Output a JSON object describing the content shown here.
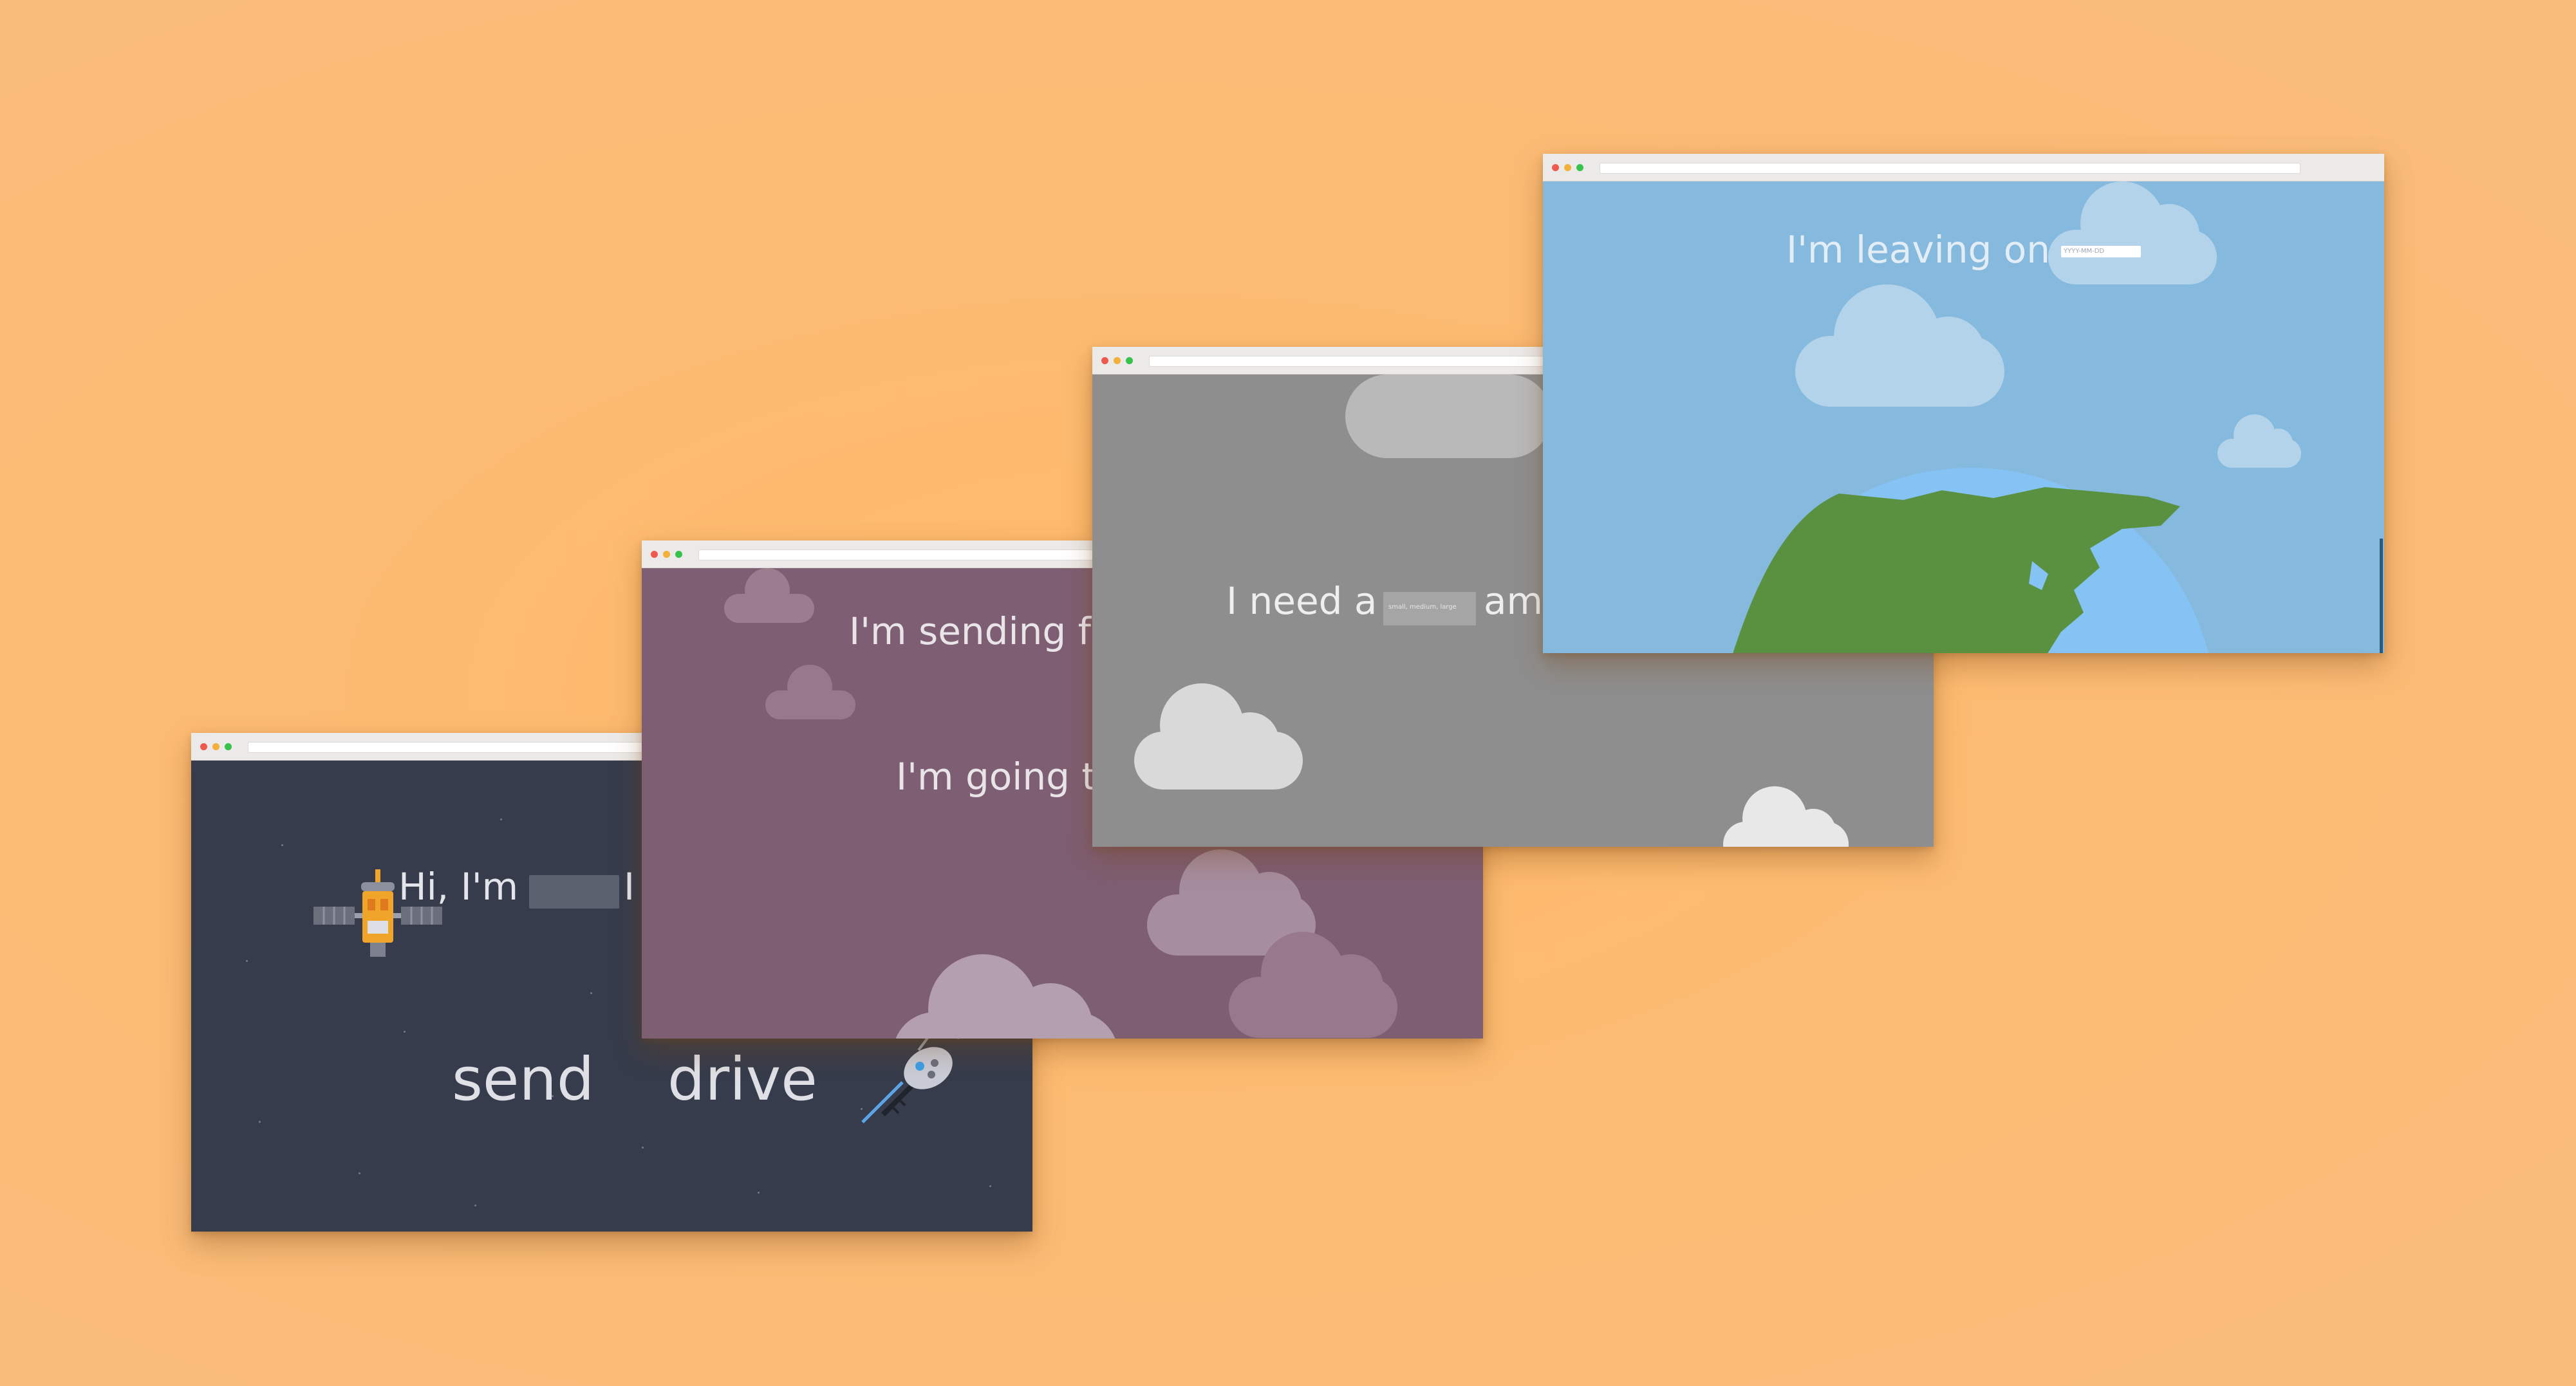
{
  "colors": {
    "background": "#fbbb75",
    "space": "#363c4b",
    "plum": "#7e5e72",
    "grey": "#8e8e8e",
    "sky": "#86b9de",
    "earth_ocean": "#85c3f5",
    "earth_land": "#5a9141"
  },
  "windows": [
    {
      "name": "space-window",
      "greeting": "Hi, I'm",
      "greeting_tail": "I",
      "action_send": "send",
      "action_drive": "drive",
      "icons": [
        "satellite-icon",
        "rover-icon"
      ]
    },
    {
      "name": "plum-window",
      "line1": "I'm sending f",
      "line2": "I'm going t"
    },
    {
      "name": "grey-window",
      "line1": "I need a",
      "line1_tail": "am",
      "field_placeholder": "small, medium, large"
    },
    {
      "name": "sky-window",
      "line1": "I'm leaving on",
      "field_placeholder": "YYYY-MM-DD",
      "icons": [
        "earth-icon"
      ]
    }
  ]
}
